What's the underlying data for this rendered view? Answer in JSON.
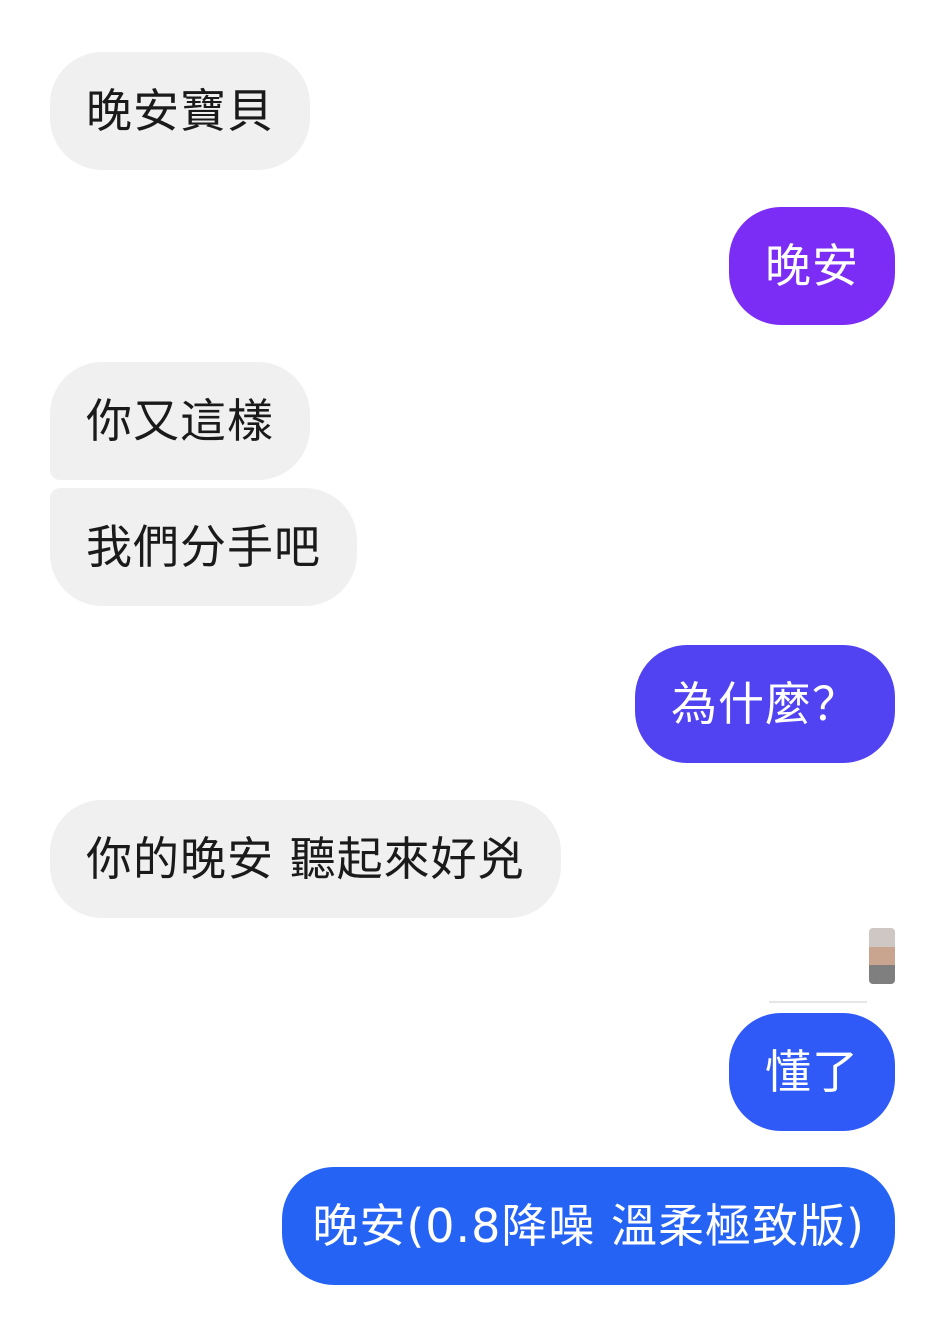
{
  "messages": [
    {
      "id": "m1",
      "from": "them",
      "text": "晚安寶貝"
    },
    {
      "id": "m2",
      "from": "me",
      "text": "晚安",
      "color": "#7b2df5"
    },
    {
      "id": "m3",
      "from": "them",
      "text": "你又這樣"
    },
    {
      "id": "m4",
      "from": "them",
      "text": "我們分手吧"
    },
    {
      "id": "m5",
      "from": "me",
      "text": "為什麼？",
      "color": "#5143f2"
    },
    {
      "id": "m6",
      "from": "them",
      "text": "你的晚安 聽起來好兇"
    },
    {
      "id": "m7",
      "from": "me",
      "text": "懂了",
      "color": "#2f5af8"
    },
    {
      "id": "m8",
      "from": "me",
      "text": "晚安(0.8降噪 溫柔極致版)",
      "color": "#2563f5"
    }
  ],
  "colors": {
    "incoming_bubble": "#f0f0f0",
    "incoming_text": "#1a1a1a",
    "outgoing_text": "#ffffff"
  },
  "read_receipt": {
    "icon": "blurred-avatar-icon"
  }
}
